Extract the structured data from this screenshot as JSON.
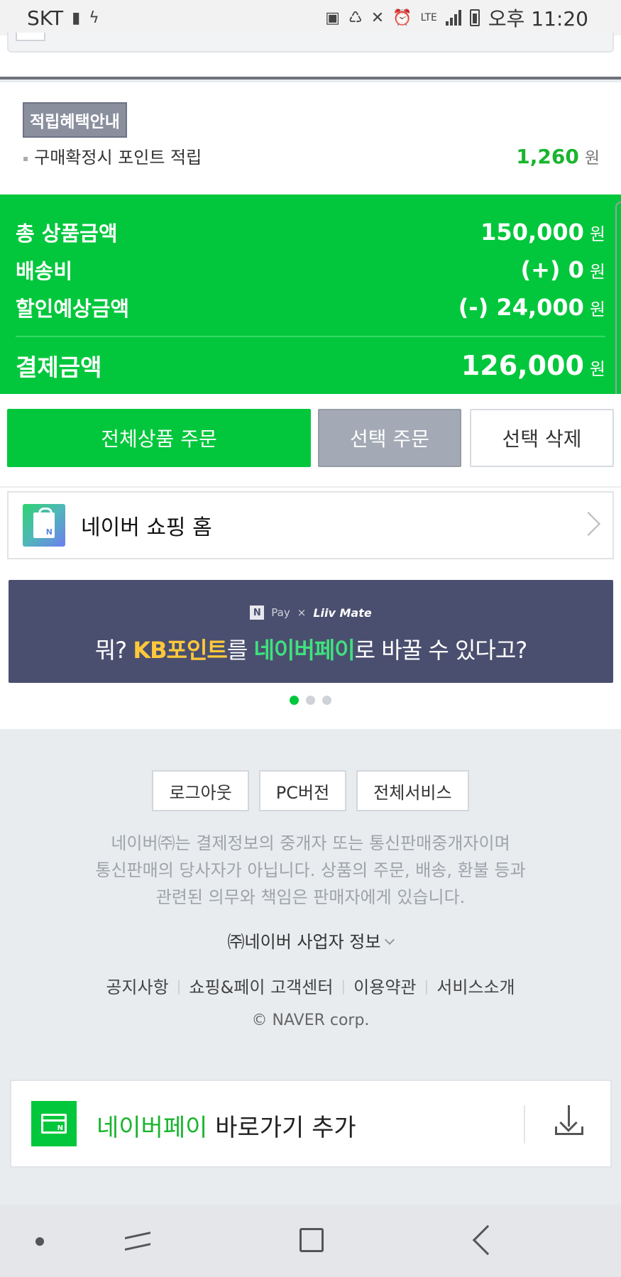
{
  "status_bar": {
    "carrier": "SKT",
    "lte": "LTE",
    "time": "오후 11:20"
  },
  "points": {
    "tag": "적립혜택안내",
    "label": "구매확정시 포인트 적립",
    "value": "1,260",
    "unit": "원"
  },
  "summary": {
    "rows": [
      {
        "label": "총 상품금액",
        "value": "150,000",
        "unit": "원"
      },
      {
        "label": "배송비",
        "value": "(+) 0",
        "unit": "원"
      },
      {
        "label": "할인예상금액",
        "value": "(-) 24,000",
        "unit": "원"
      }
    ],
    "total": {
      "label": "결제금액",
      "value": "126,000",
      "unit": "원"
    },
    "accent_color": "#02c73c"
  },
  "buttons": {
    "order_all": "전체상품 주문",
    "order_selected": "선택 주문",
    "delete_selected": "선택 삭제"
  },
  "shopping_home": {
    "label": "네이버 쇼핑 홈",
    "icon": "naver-shopping-bag-icon"
  },
  "banner": {
    "npay_badge": "N",
    "pay_label": "Pay",
    "x_mark": "×",
    "liiv_label": "Liiv Mate",
    "text_pre": "뭐? ",
    "text_kb": "KB포인트",
    "text_mid": "를 ",
    "text_npay": "네이버페이",
    "text_post": "로 바꿀 수 있다고?",
    "pagination_total": 3,
    "pagination_active": 1
  },
  "footer": {
    "buttons": [
      "로그아웃",
      "PC버전",
      "전체서비스"
    ],
    "notice_lines": [
      "네이버㈜는 결제정보의 중개자 또는 통신판매중개자이며",
      "통신판매의 당사자가 아닙니다. 상품의 주문, 배송, 환불 등과",
      "관련된 의무와 책임은 판매자에게 있습니다."
    ],
    "business_info": "㈜네이버 사업자 정보",
    "links": [
      "공지사항",
      "쇼핑&페이 고객센터",
      "이용약관",
      "서비스소개"
    ],
    "copyright": "© NAVER corp."
  },
  "pay_shortcut": {
    "brand": "네이버페이",
    "label": " 바로가기 추가",
    "icon": "naver-pay-card-icon",
    "action_icon": "download-icon"
  },
  "nav_bar": {
    "icons": [
      "nav-dot-icon",
      "recent-apps-icon",
      "home-icon",
      "back-icon"
    ]
  }
}
